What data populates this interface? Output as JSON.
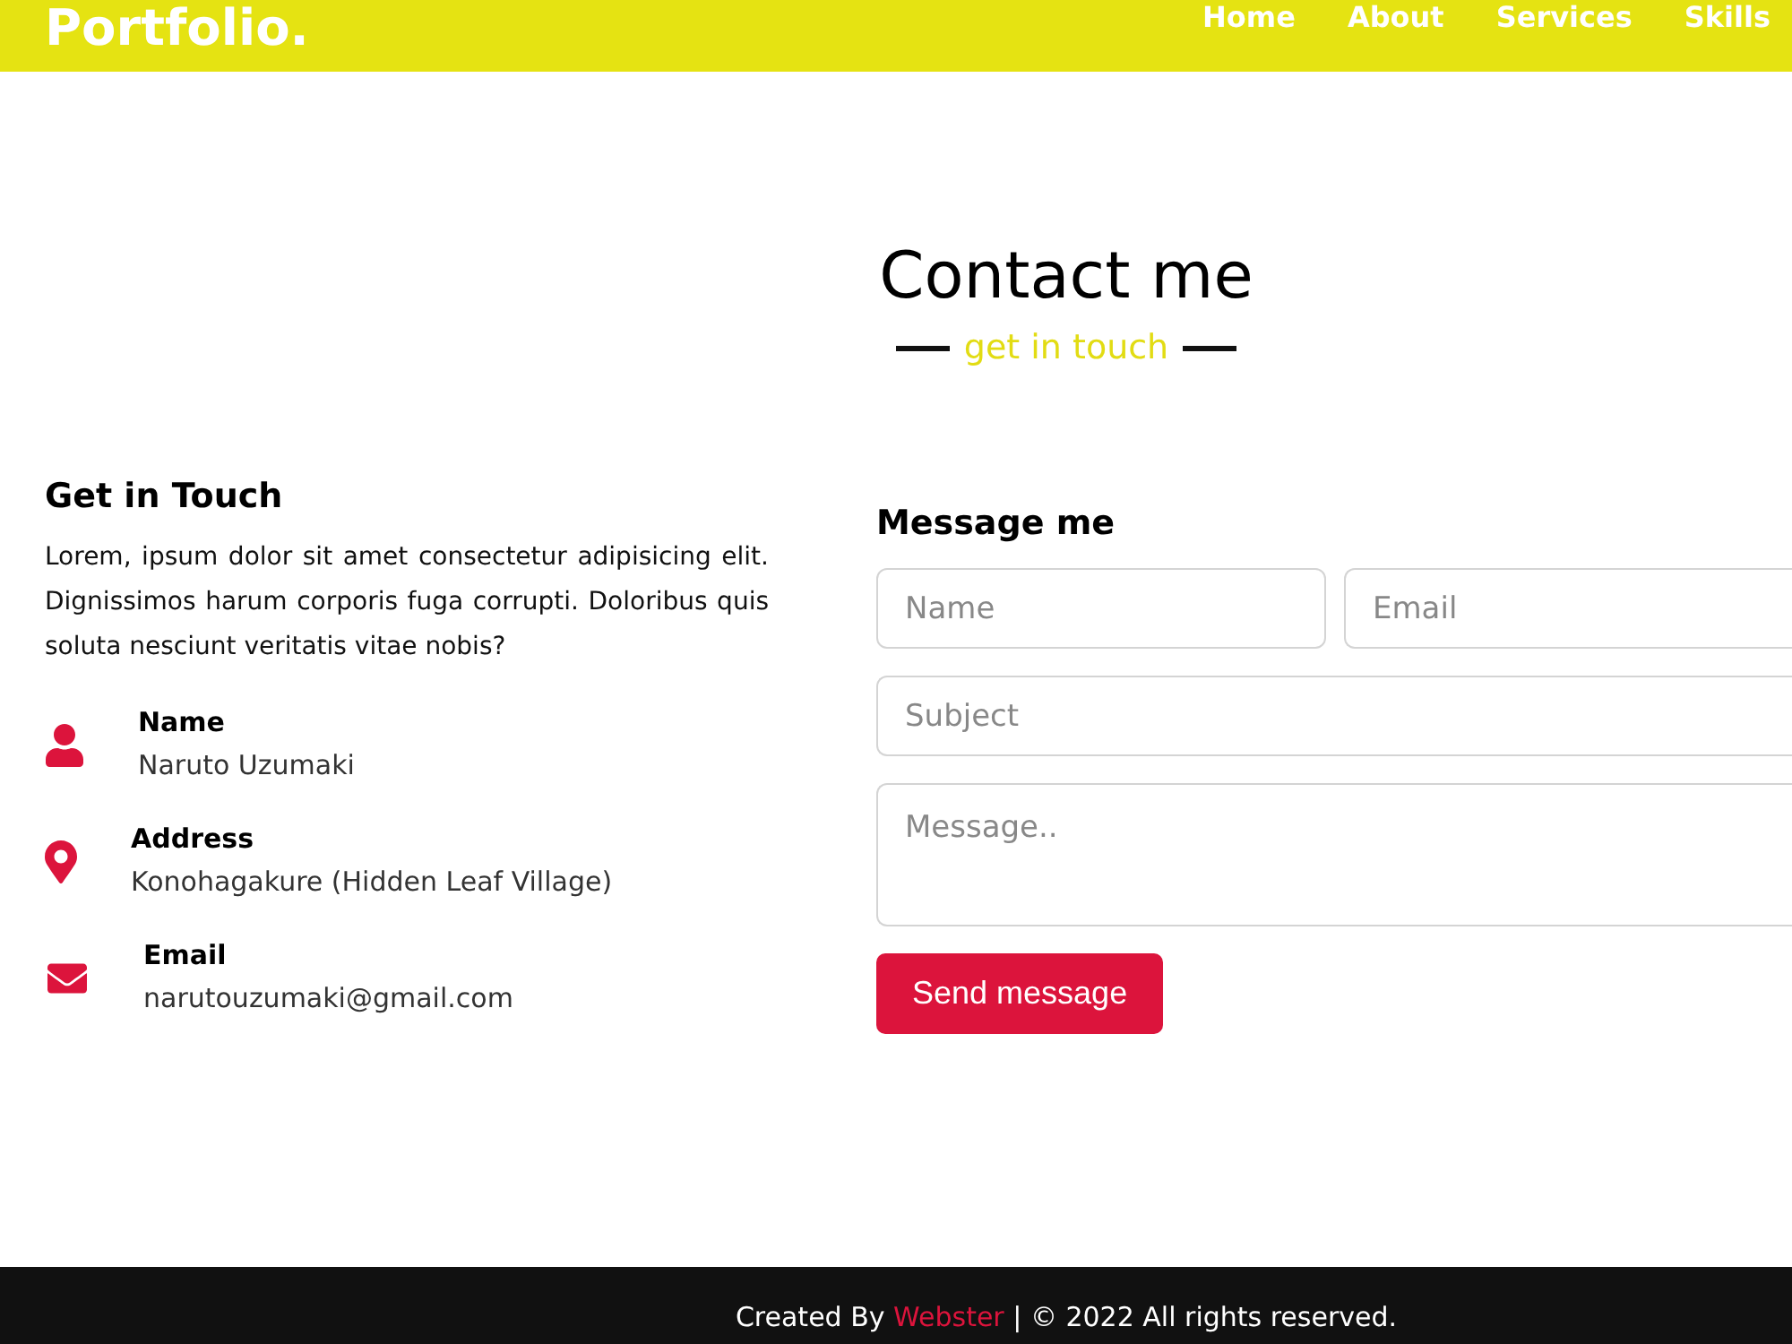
{
  "header": {
    "logo": "Portfolio.",
    "nav": [
      {
        "label": "Home"
      },
      {
        "label": "About"
      },
      {
        "label": "Services"
      },
      {
        "label": "Skills"
      }
    ]
  },
  "section": {
    "title": "Contact me",
    "subtitle": "get in touch"
  },
  "info": {
    "heading": "Get in Touch",
    "text": "Lorem, ipsum dolor sit amet consectetur adipisicing elit. Dignissimos harum corporis fuga corrupti. Doloribus quis soluta nesciunt veritatis vitae nobis?",
    "items": [
      {
        "kind": "person",
        "label": "Name",
        "value": "Naruto Uzumaki"
      },
      {
        "kind": "location",
        "label": "Address",
        "value": "Konohagakure (Hidden Leaf Village)"
      },
      {
        "kind": "email",
        "label": "Email",
        "value": "narutouzumaki@gmail.com"
      }
    ]
  },
  "form": {
    "heading": "Message me",
    "rows": [
      [
        {
          "kind": "input",
          "placeholder": "Name"
        },
        {
          "kind": "input",
          "placeholder": "Email"
        }
      ],
      [
        {
          "kind": "input",
          "placeholder": "Subject"
        }
      ],
      [
        {
          "kind": "textarea",
          "placeholder": "Message.."
        }
      ]
    ],
    "button": "Send message"
  },
  "footer": {
    "prefix": "Created By",
    "link": "Webster",
    "suffix": "| © 2022 All rights reserved."
  }
}
